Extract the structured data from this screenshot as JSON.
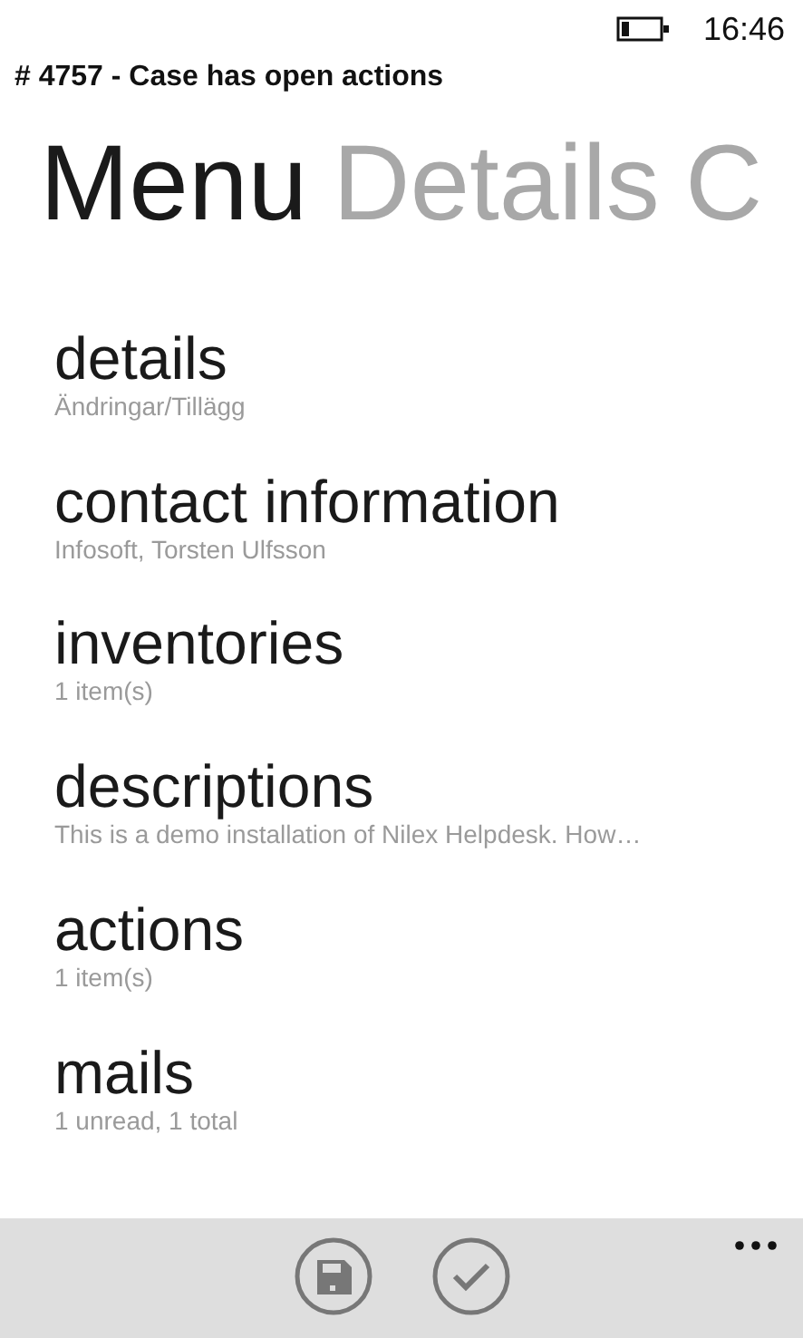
{
  "status_bar": {
    "time": "16:46"
  },
  "title": "# 4757 - Case has open actions",
  "pivot": [
    {
      "label": "Menu",
      "selected": true
    },
    {
      "label": "Details",
      "selected": false
    },
    {
      "label": "C",
      "selected": false
    }
  ],
  "menu_items": [
    {
      "title": "details",
      "subtitle": "Ändringar/Tillägg"
    },
    {
      "title": "contact information",
      "subtitle": "Infosoft, Torsten Ulfsson"
    },
    {
      "title": "inventories",
      "subtitle": "1 item(s)"
    },
    {
      "title": "descriptions",
      "subtitle": "This is a demo installation of Nilex Helpdesk. How…"
    },
    {
      "title": "actions",
      "subtitle": "1 item(s)"
    },
    {
      "title": "mails",
      "subtitle": "1 unread, 1 total"
    }
  ],
  "app_bar": {
    "buttons": [
      {
        "kind": "save"
      },
      {
        "kind": "check"
      }
    ]
  }
}
